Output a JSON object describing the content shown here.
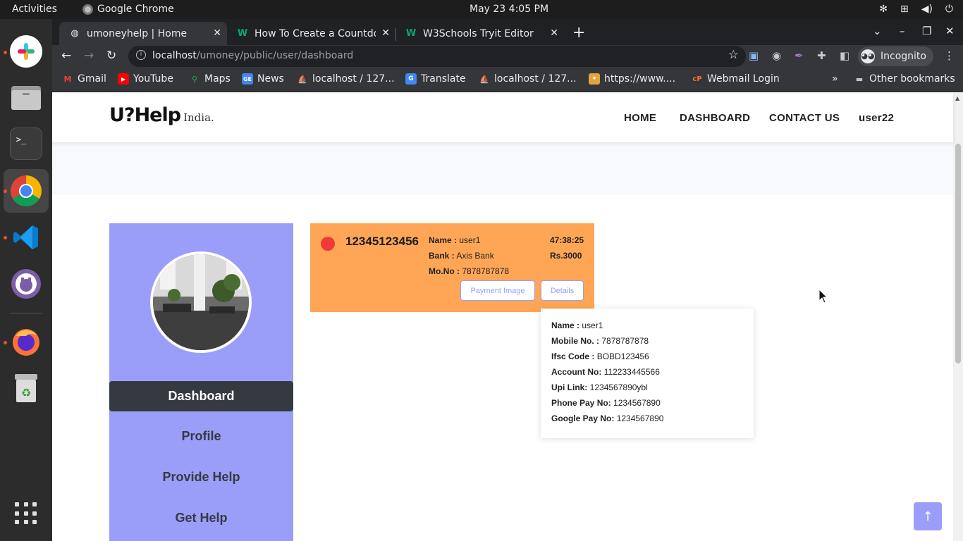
{
  "system_bar": {
    "activities": "Activities",
    "app_name": "Google Chrome",
    "clock": "May 23  4:05 PM"
  },
  "dock": {
    "apps": [
      "slack-icon",
      "files-icon",
      "terminal-icon",
      "chrome-icon",
      "vscode-icon",
      "github-desktop-icon",
      "firefox-icon",
      "trash-icon",
      "show-apps-icon"
    ]
  },
  "browser": {
    "tabs": [
      {
        "title": "umoneyhelp | Home",
        "active": true
      },
      {
        "title": "How To Create a Countdo",
        "active": false
      },
      {
        "title": "W3Schools Tryit Editor",
        "active": false
      }
    ],
    "url_host": "localhost",
    "url_path": "/umoney/public/user/dashboard",
    "profile_label": "Incognito",
    "bookmarks": [
      {
        "label": "Gmail",
        "icon": "gmail-icon"
      },
      {
        "label": "YouTube",
        "icon": "youtube-icon"
      },
      {
        "label": "Maps",
        "icon": "maps-icon"
      },
      {
        "label": "News",
        "icon": "news-icon"
      },
      {
        "label": "localhost / 127...",
        "icon": "phpmyadmin-icon"
      },
      {
        "label": "Translate",
        "icon": "translate-icon"
      },
      {
        "label": "localhost / 127...",
        "icon": "phpmyadmin-icon"
      },
      {
        "label": "https://www....",
        "icon": "site-icon"
      },
      {
        "label": "Webmail Login",
        "icon": "cpanel-icon"
      }
    ],
    "bookmarks_overflow": "»",
    "other_bookmarks": "Other bookmarks"
  },
  "site": {
    "logo_main": "U?Help",
    "logo_sub": "India.",
    "nav": [
      "HOME",
      "DASHBOARD",
      "CONTACT US",
      "user22"
    ],
    "sidebar_menu": [
      {
        "label": "Dashboard",
        "active": true
      },
      {
        "label": "Profile",
        "active": false
      },
      {
        "label": "Provide Help",
        "active": false
      },
      {
        "label": "Get Help",
        "active": false
      }
    ],
    "card": {
      "id": "12345123456",
      "name_label": "Name :",
      "name_value": "user1",
      "bank_label": "Bank :",
      "bank_value": "Axis Bank",
      "mobile_label": "Mo.No :",
      "mobile_value": "7878787878",
      "timer": "47:38:25",
      "amount": "Rs.3000",
      "payment_image_btn": "Payment Image",
      "details_btn": "Details",
      "status_color": "#f03a3a"
    },
    "details": [
      {
        "label": "Name :",
        "value": "user1"
      },
      {
        "label": "Mobile No. :",
        "value": "7878787878"
      },
      {
        "label": "Ifsc Code :",
        "value": "BOBD123456"
      },
      {
        "label": "Account No:",
        "value": "112233445566"
      },
      {
        "label": "Upi Link:",
        "value": "1234567890ybl"
      },
      {
        "label": "Phone Pay No:",
        "value": "1234567890"
      },
      {
        "label": "Google Pay No:",
        "value": "1234567890"
      }
    ],
    "back_to_top": "↑"
  },
  "colors": {
    "accent": "#9a9ef9",
    "card_bg": "#fea655",
    "sidebar_active": "#343a40"
  }
}
